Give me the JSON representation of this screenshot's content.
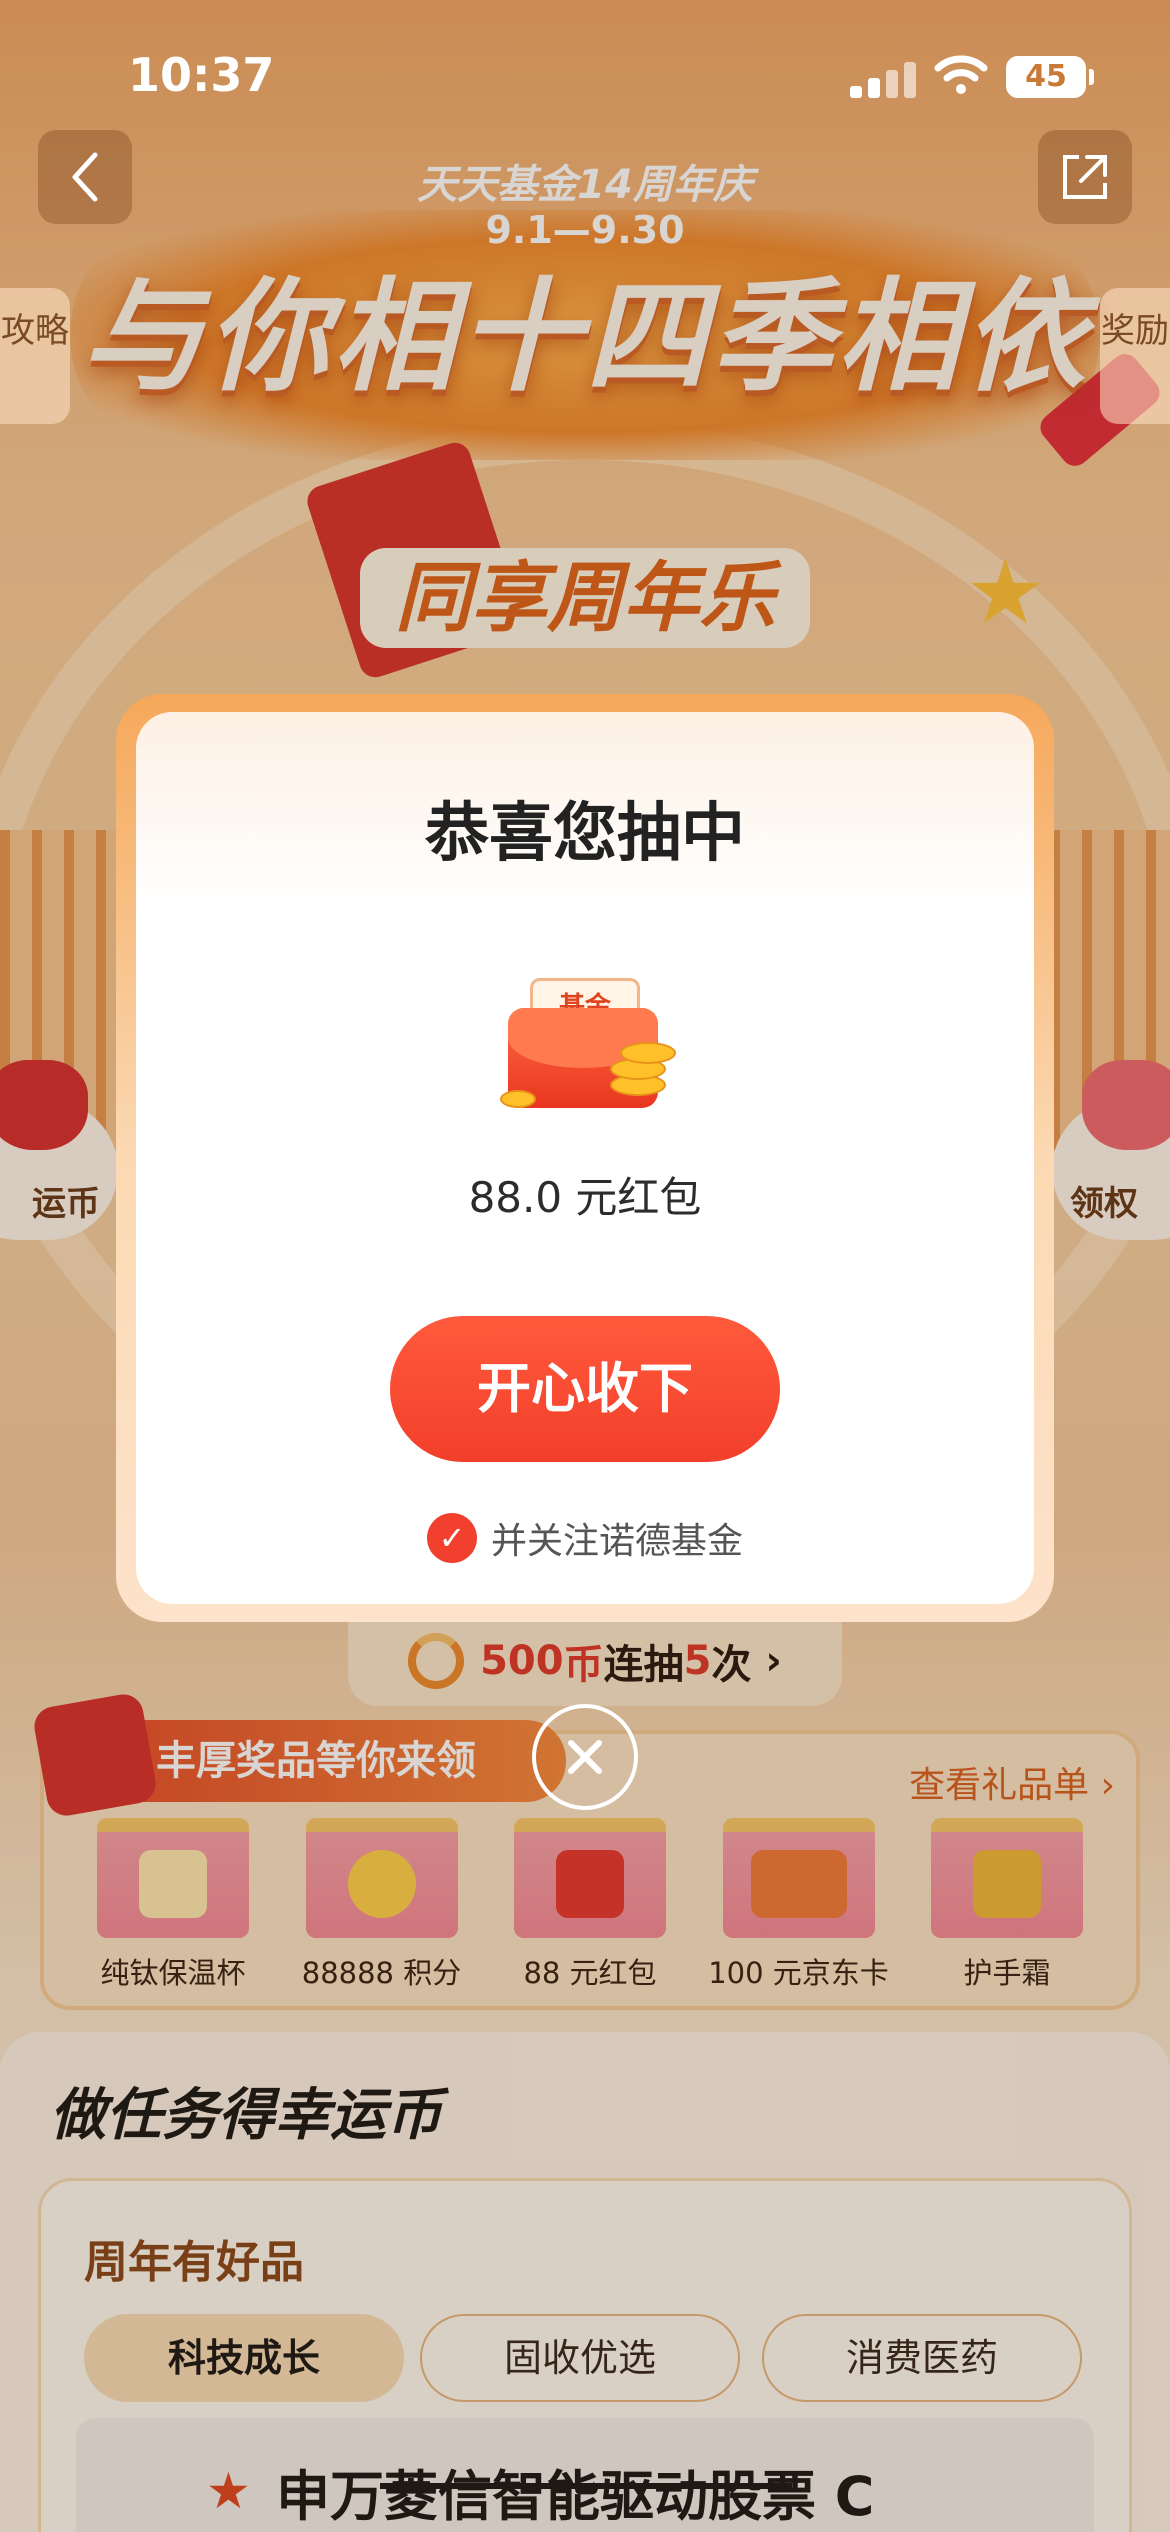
{
  "status_bar": {
    "time": "10:37",
    "battery": "45"
  },
  "hero": {
    "subtitle": "天天基金14周年庆",
    "dates": "9.1—9.30",
    "title": "与你相十四季相依",
    "badge": "同享周年乐"
  },
  "side_tabs": {
    "left": "攻略",
    "right": "奖励"
  },
  "side_bubbles": {
    "left": "运币",
    "right": "领权"
  },
  "modal": {
    "title": "恭喜您抽中",
    "envelope_text": "基金",
    "prize_value": "88.0 元红包",
    "accept_label": "开心收下",
    "follow_check": "✓",
    "follow_label": "并关注诺德基金"
  },
  "draw_bar": {
    "coins": "500",
    "coin_unit": "币",
    "text": "连抽",
    "count": "5",
    "unit": "次",
    "chevron": "›"
  },
  "prizes": {
    "banner": "丰厚奖品等你来领",
    "link": "查看礼品单",
    "link_chevron": "›",
    "items": [
      {
        "label": "纯钛保温杯",
        "icon": "thermos-icon"
      },
      {
        "label": "88888 积分",
        "icon": "points-coin-icon"
      },
      {
        "label": "88 元红包",
        "icon": "red-envelope-icon"
      },
      {
        "label": "100 元京东卡",
        "icon": "jd-card-icon"
      },
      {
        "label": "护手霜",
        "icon": "hand-cream-icon"
      }
    ]
  },
  "tasks": {
    "title": "做任务得幸运币",
    "card_title": "周年有好品",
    "tabs": [
      {
        "label": "科技成长",
        "active": true
      },
      {
        "label": "固收优选",
        "active": false
      },
      {
        "label": "消费医药",
        "active": false
      }
    ],
    "fund_name": "申万菱信智能驱动股票 C"
  },
  "colors": {
    "accent": "#f2402e",
    "brand_orange": "#e0641c"
  }
}
